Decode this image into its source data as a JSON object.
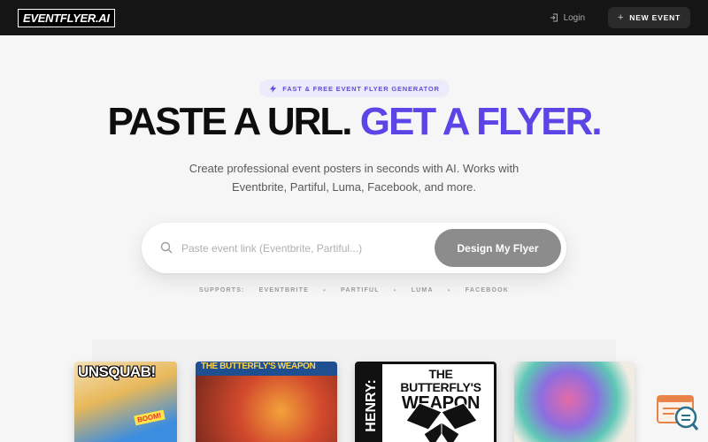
{
  "nav": {
    "logo": "EVENTFLYER.AI",
    "login": "Login",
    "new_event": "NEW EVENT"
  },
  "hero": {
    "badge": "FAST & FREE EVENT FLYER GENERATOR",
    "headline_part1": "PASTE A URL.",
    "headline_part2": "GET A FLYER.",
    "subtitle_line1": "Create professional event posters in seconds with AI. Works with",
    "subtitle_line2": "Eventbrite, Partiful, Luma, Facebook, and more."
  },
  "search": {
    "placeholder": "Paste event link (Eventbrite, Partiful...)",
    "value": "",
    "button": "Design My Flyer"
  },
  "supports": {
    "label": "SUPPORTS:",
    "platforms": [
      "EVENTBRITE",
      "PARTIFUL",
      "LUMA",
      "FACEBOOK"
    ]
  },
  "flyers": {
    "f1_title": "UNSQUAB!",
    "f1_boom": "BOOM!",
    "f2_title": "THE BUTTERFLY'S WEAPON",
    "f3_side": "HENRY:",
    "f3_title_line1": "THE BUTTERFLY'S",
    "f3_title_line2": "WEAPON"
  },
  "colors": {
    "accent": "#5b45e6",
    "nav_bg": "#151515",
    "button_bg": "#8c8c8c"
  }
}
